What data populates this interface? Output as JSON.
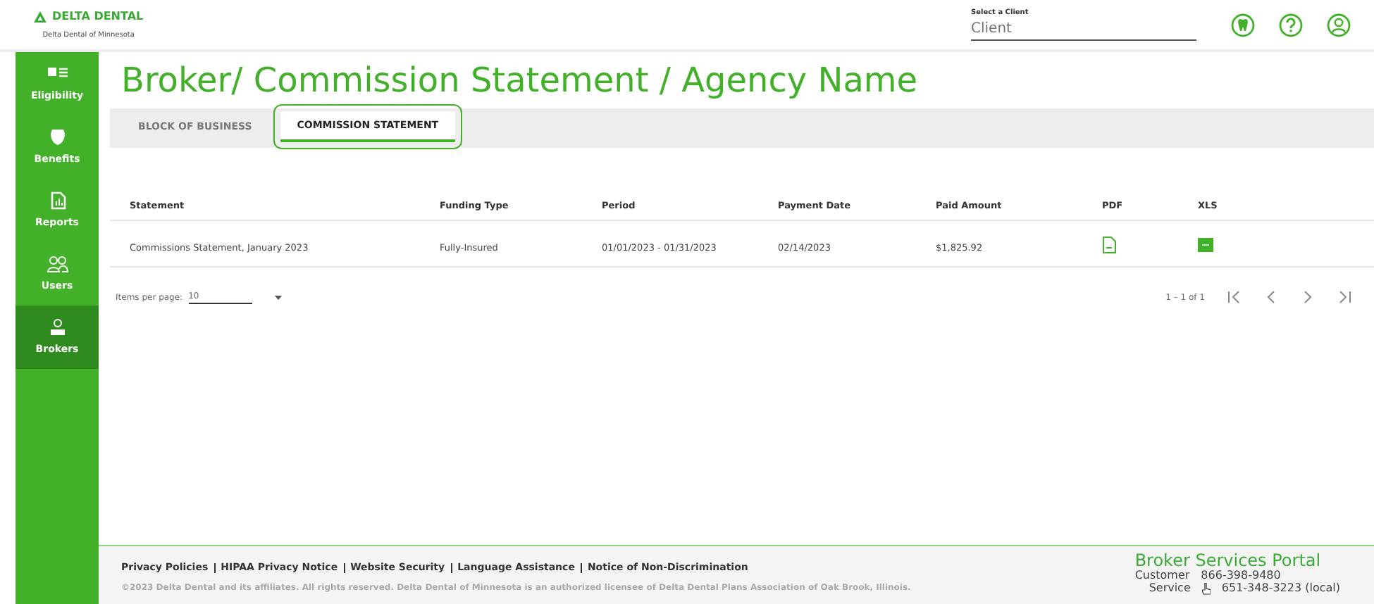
{
  "header": {
    "brand": "DELTA DENTAL",
    "subbrand": "Delta Dental of Minnesota",
    "client_field": {
      "label": "Select a Client",
      "placeholder": "Client"
    }
  },
  "sidebar": {
    "items": [
      {
        "label": "Eligibility",
        "kind": "card",
        "selected": false
      },
      {
        "label": "Benefits",
        "kind": "shield",
        "selected": false
      },
      {
        "label": "Reports",
        "kind": "report",
        "selected": false
      },
      {
        "label": "Users",
        "kind": "users",
        "selected": false
      },
      {
        "label": "Brokers",
        "kind": "broker",
        "selected": true
      }
    ]
  },
  "page_title": "Broker/ Commission Statement / Agency Name",
  "tabs": [
    {
      "label": "BLOCK OF BUSINESS",
      "selected": false
    },
    {
      "label": "COMMISSION STATEMENT",
      "selected": true
    }
  ],
  "table": {
    "columns": [
      "Statement",
      "Funding Type",
      "Period",
      "Payment Date",
      "Paid Amount",
      "PDF",
      "XLS"
    ],
    "rows": [
      [
        "Commissions Statement, January 2023",
        "Fully-Insured",
        "01/01/2023 - 01/31/2023",
        "02/14/2023",
        "$1,825.92"
      ]
    ]
  },
  "paginator": {
    "label": "Items per page:",
    "page_size": "10",
    "range": "1 – 1 of 1"
  },
  "footer": {
    "links": [
      "Privacy Policies",
      "HIPAA Privacy Notice",
      "Website Security",
      "Language Assistance",
      "Notice of Non-Discrimination"
    ],
    "copyright": "©2023 Delta Dental and its affiliates. All rights reserved. Delta Dental of Minnesota is an authorized licensee of Delta Dental Plans Association of Oak Brook, Illinois.",
    "portal": "Broker Services Portal",
    "contacts": [
      {
        "label": "Customer",
        "phone": "866-398-9480"
      },
      {
        "label": "Service",
        "phone": "651-348-3223 (local)"
      }
    ]
  }
}
